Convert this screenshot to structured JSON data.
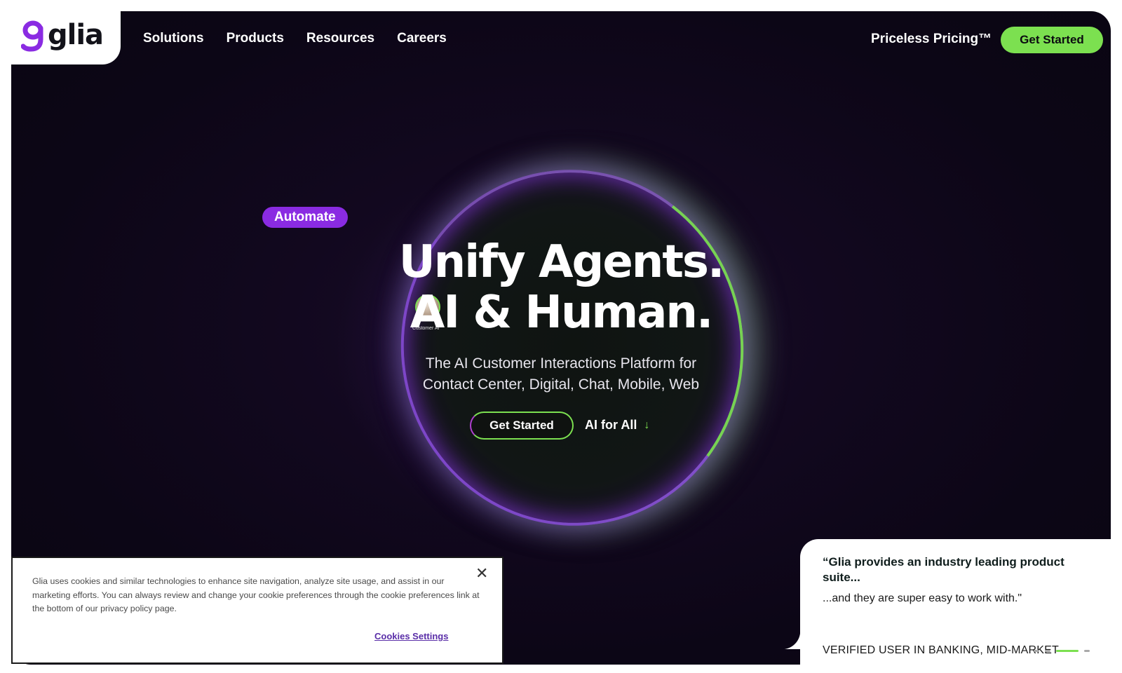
{
  "brand": {
    "name": "glia",
    "logo_icon": "glia-logo-icon"
  },
  "nav": {
    "items": [
      {
        "label": "Solutions"
      },
      {
        "label": "Products"
      },
      {
        "label": "Resources"
      },
      {
        "label": "Careers"
      }
    ],
    "pricing_label": "Priceless Pricing™",
    "cta_label": "Get Started"
  },
  "hero": {
    "tag": "Automate",
    "headline_line1": "Unify Agents.",
    "headline_line2": "AI & Human.",
    "avatar_label": "Customer AI",
    "subtitle": "The AI Customer Interactions Platform for Contact Center, Digital, Chat, Mobile, Web",
    "cta_label": "Get Started",
    "secondary_label": "AI for All",
    "secondary_icon": "arrow-down-icon"
  },
  "testimonial": {
    "title": "“Glia provides an industry leading product suite...",
    "body": "...and they are super easy to work with.\"",
    "author": "VERIFIED USER IN BANKING, MID-MARKET",
    "carousel_dots": 4,
    "active_dot": 3
  },
  "cookie_banner": {
    "text": "Glia uses cookies and similar technologies to enhance site navigation, analyze site usage, and assist in our marketing efforts. You can always review and change your cookie preferences through the cookie preferences link at the bottom of our privacy policy page.",
    "settings_label": "Cookies Settings",
    "close_icon": "close-icon"
  },
  "colors": {
    "accent_green": "#7ce050",
    "accent_purple": "#8a2be2",
    "hero_bg": "#0c0616",
    "link_purple": "#5a2ea8"
  }
}
